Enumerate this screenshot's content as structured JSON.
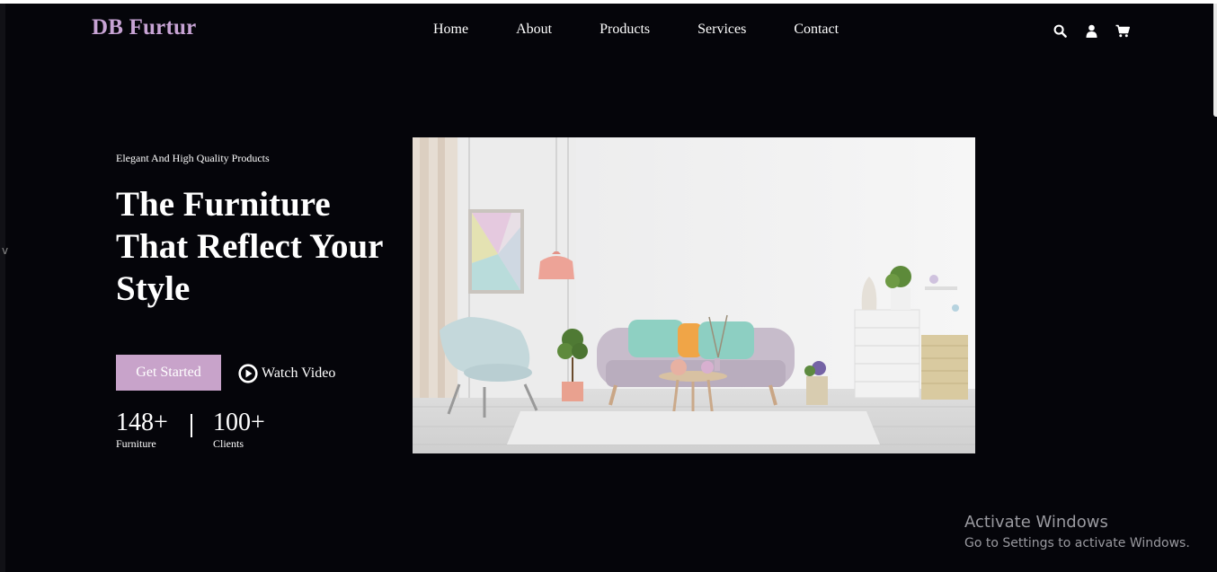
{
  "brand": {
    "name": "DB Furtur",
    "color": "#c7a3d4"
  },
  "nav": {
    "items": [
      {
        "label": "Home"
      },
      {
        "label": "About"
      },
      {
        "label": "Products"
      },
      {
        "label": "Services"
      },
      {
        "label": "Contact"
      }
    ]
  },
  "header_icons": [
    "search-icon",
    "user-icon",
    "cart-icon"
  ],
  "hero": {
    "tagline": "Elegant And High Quality Products",
    "headline": "The Furniture That Reflect Your Style",
    "cta_label": "Get Started",
    "watch_label": "Watch Video",
    "accent": "#c8a3ca"
  },
  "stats": [
    {
      "value": "148+",
      "label": "Furniture"
    },
    {
      "value": "100+",
      "label": "Clients"
    }
  ],
  "os_watermark": {
    "title": "Activate Windows",
    "subtitle": "Go to Settings to activate Windows."
  },
  "colors": {
    "background": "#05050a",
    "text": "#ffffff"
  }
}
